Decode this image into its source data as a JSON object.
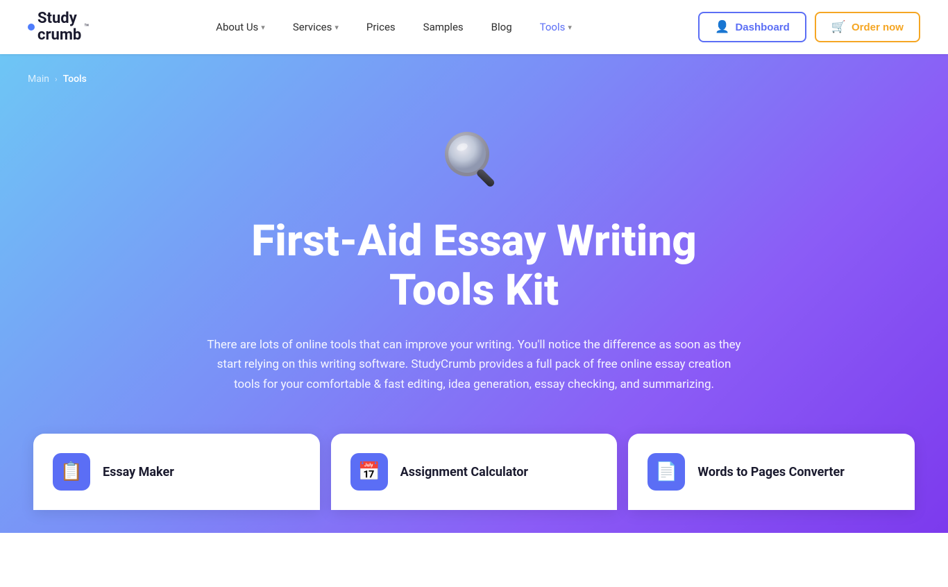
{
  "site": {
    "name": "Study crumb",
    "name_line1": "Study",
    "name_line2": "crumb",
    "tm": "™"
  },
  "nav": {
    "about_us": "About Us",
    "services": "Services",
    "prices": "Prices",
    "samples": "Samples",
    "blog": "Blog",
    "tools": "Tools"
  },
  "header": {
    "dashboard_label": "Dashboard",
    "order_label": "Order now"
  },
  "breadcrumb": {
    "main": "Main",
    "separator": "›",
    "current": "Tools"
  },
  "hero": {
    "title_line1": "First-Aid Essay Writing",
    "title_line2": "Tools Kit",
    "description": "There are lots of online tools that can improve your writing. You'll notice the difference as soon as they start relying on this writing software. StudyCrumb provides a full pack of free online essay creation tools for your comfortable & fast editing, idea generation, essay checking, and summarizing."
  },
  "tool_cards": [
    {
      "id": "essay-maker",
      "label": "Essay Maker",
      "icon": "📋"
    },
    {
      "id": "assignment-calculator",
      "label": "Assignment Calculator",
      "icon": "📅"
    },
    {
      "id": "words-to-pages",
      "label": "Words to Pages Converter",
      "icon": "📄"
    }
  ],
  "colors": {
    "accent_blue": "#5b6ef5",
    "accent_orange": "#f5a623",
    "hero_gradient_start": "#6ec6f5",
    "hero_gradient_end": "#7c3aed"
  }
}
